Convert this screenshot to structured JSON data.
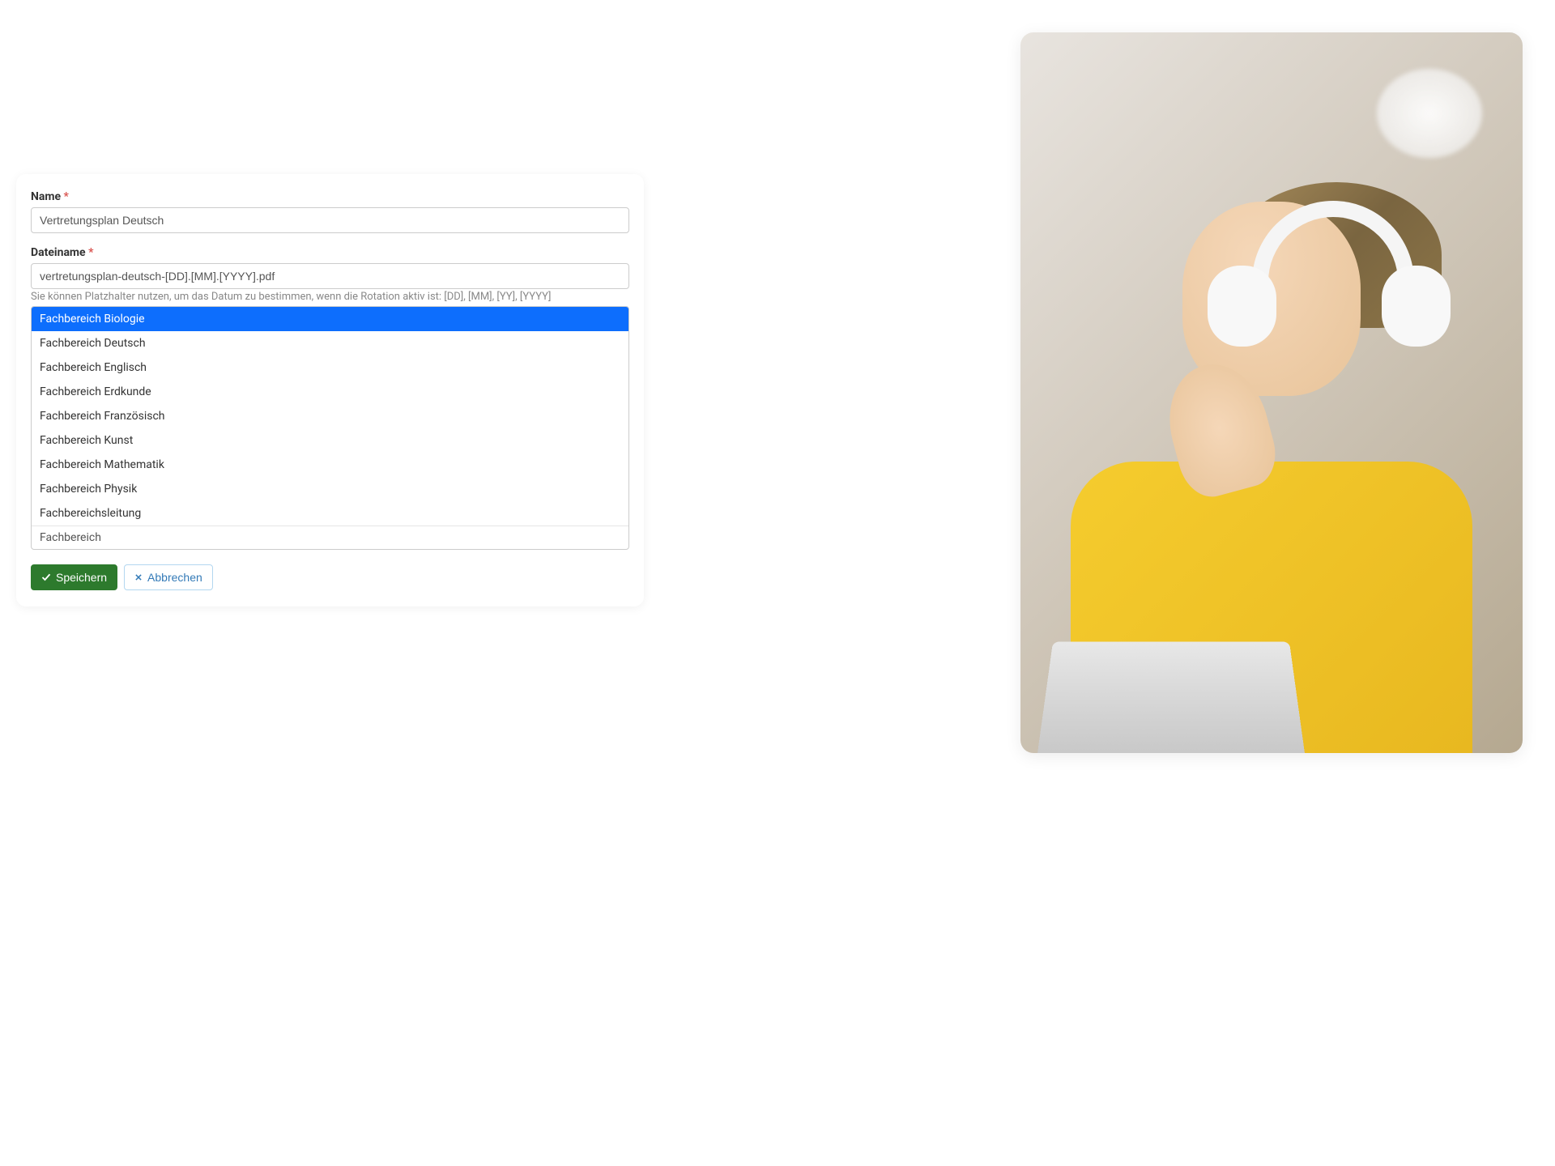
{
  "form": {
    "name_label": "Name",
    "name_value": "Vertretungsplan Deutsch",
    "filename_label": "Dateiname",
    "filename_value": "vertretungsplan-deutsch-[DD].[MM].[YYYY].pdf",
    "filename_helper": "Sie können Platzhalter nutzen, um das Datum zu bestimmen, wenn die Rotation aktiv ist: [DD], [MM], [YY], [YYYY]"
  },
  "dropdown": {
    "items": [
      "Fachbereich Biologie",
      "Fachbereich Deutsch",
      "Fachbereich Englisch",
      "Fachbereich Erdkunde",
      "Fachbereich Französisch",
      "Fachbereich Kunst",
      "Fachbereich Mathematik",
      "Fachbereich Physik",
      "Fachbereichsleitung"
    ],
    "search_value": "Fachbereich",
    "selected_index": 0
  },
  "buttons": {
    "save": "Speichern",
    "cancel": "Abbrechen"
  }
}
